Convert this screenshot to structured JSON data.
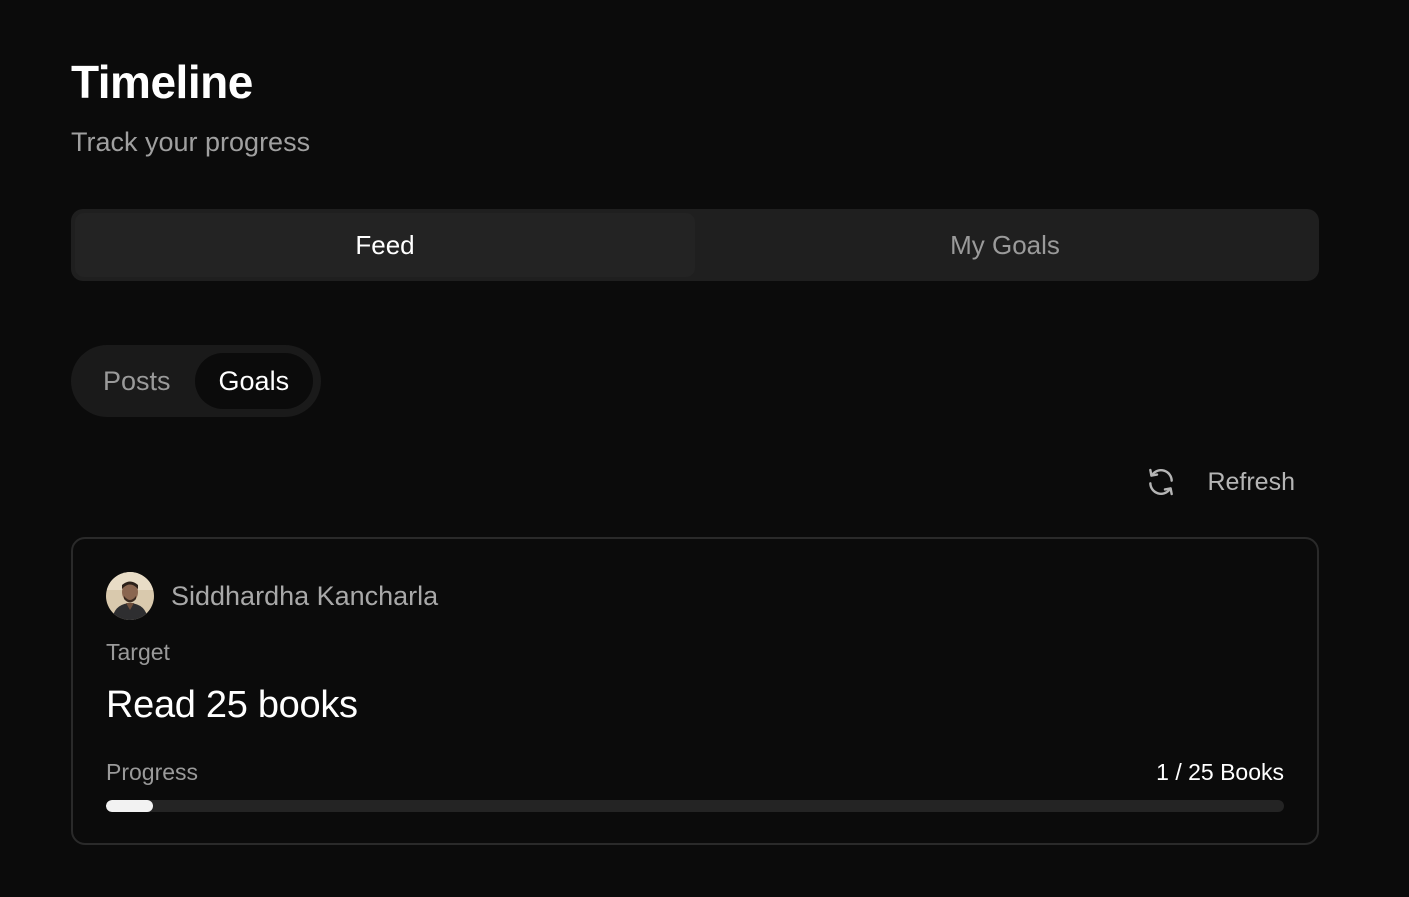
{
  "header": {
    "title": "Timeline",
    "subtitle": "Track your progress"
  },
  "main_tabs": [
    {
      "label": "Feed",
      "active": true
    },
    {
      "label": "My Goals",
      "active": false
    }
  ],
  "sub_tabs": [
    {
      "label": "Posts",
      "active": false
    },
    {
      "label": "Goals",
      "active": true
    }
  ],
  "refresh": {
    "label": "Refresh",
    "icon": "refresh-icon"
  },
  "goal_card": {
    "user_name": "Siddhardha Kancharla",
    "avatar_icon": "user-avatar",
    "target_label": "Target",
    "goal_title": "Read 25 books",
    "progress_label": "Progress",
    "progress_text": "1 / 25 Books",
    "progress_current": 1,
    "progress_total": 25
  },
  "colors": {
    "background": "#0b0b0b",
    "surface": "#1f1f1f",
    "muted_text": "#9a9a9a",
    "progress_fill": "#f2f2f2"
  }
}
